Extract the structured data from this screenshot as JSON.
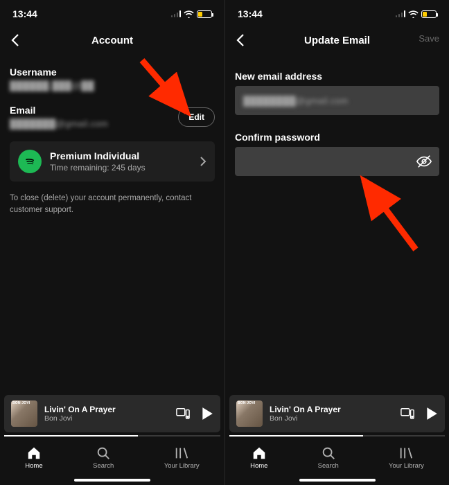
{
  "status": {
    "time": "13:44"
  },
  "screen1": {
    "header": {
      "title": "Account"
    },
    "username_label": "Username",
    "username_value": "██████.███@██",
    "email_label": "Email",
    "email_value": "███████@gmail.com",
    "edit_label": "Edit",
    "plan": {
      "name": "Premium Individual",
      "sub": "Time remaining: 245 days"
    },
    "close_note": "To close (delete) your account permanently, contact customer support."
  },
  "screen2": {
    "header": {
      "title": "Update Email",
      "save": "Save"
    },
    "new_email_label": "New email address",
    "new_email_value": "████████@gmail.com",
    "confirm_label": "Confirm password"
  },
  "now_playing": {
    "title": "Livin' On A Prayer",
    "artist": "Bon Jovi",
    "art_text": "BON JOVI"
  },
  "tabs": {
    "home": "Home",
    "search": "Search",
    "library": "Your Library"
  }
}
